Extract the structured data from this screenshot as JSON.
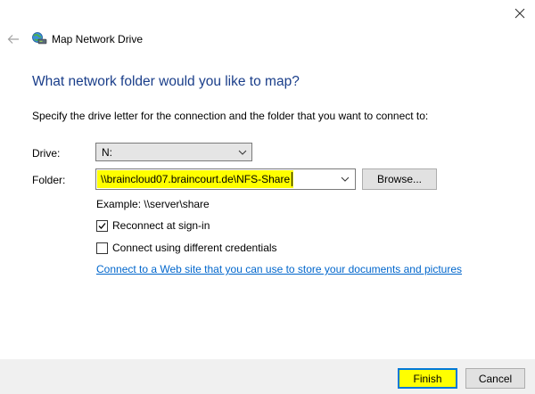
{
  "window": {
    "title": "Map Network Drive",
    "close_icon": "close-icon",
    "back_icon": "back-arrow-icon",
    "app_icon": "network-drive-icon"
  },
  "heading": "What network folder would you like to map?",
  "instruction": "Specify the drive letter for the connection and the folder that you want to connect to:",
  "drive": {
    "label": "Drive:",
    "value": "N:"
  },
  "folder": {
    "label": "Folder:",
    "value": "\\\\braincloud07.braincourt.de\\NFS-Share",
    "highlight_color": "#ffff00"
  },
  "browse_label": "Browse...",
  "example": "Example: \\\\server\\share",
  "reconnect": {
    "label": "Reconnect at sign-in",
    "checked": true
  },
  "credentials": {
    "label": "Connect using different credentials",
    "checked": false
  },
  "web_link": "Connect to a Web site that you can use to store your documents and pictures",
  "buttons": {
    "finish": "Finish",
    "cancel": "Cancel"
  },
  "colors": {
    "heading": "#1a3e8a",
    "link": "#0066cc",
    "focus_border": "#0078d7",
    "highlight": "#ffff00",
    "footer_bg": "#f0f0f0"
  }
}
